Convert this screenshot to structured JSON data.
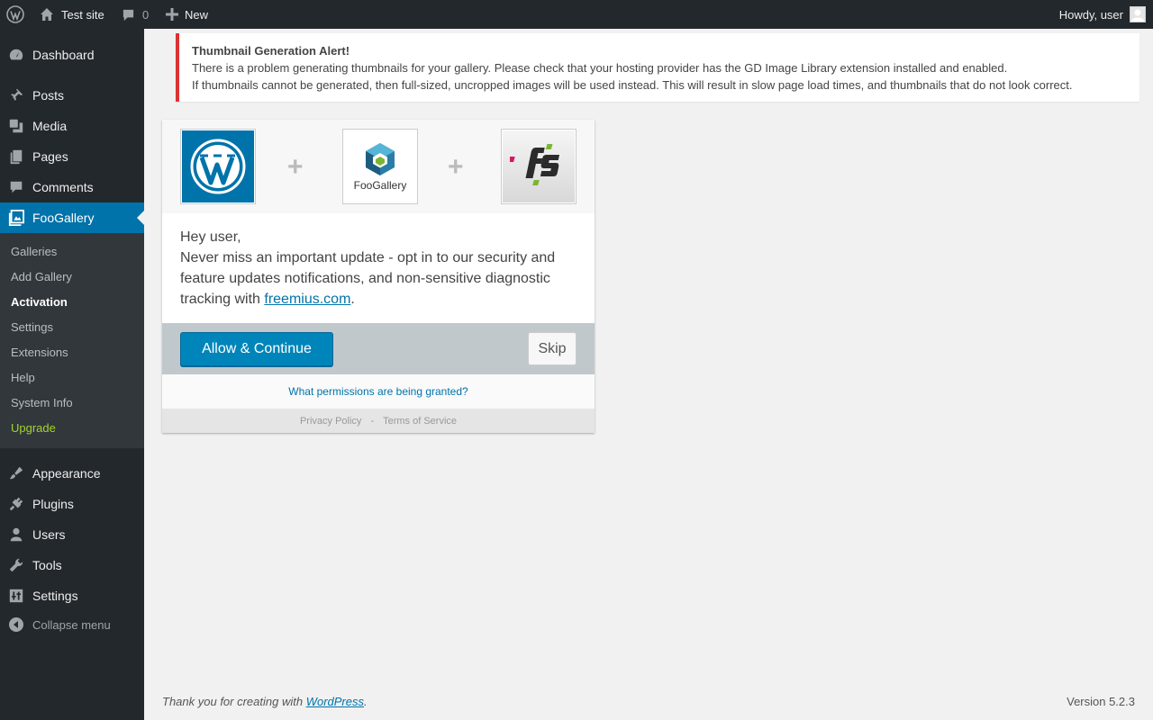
{
  "adminbar": {
    "site_name": "Test site",
    "comments_count": "0",
    "new_label": "New",
    "howdy": "Howdy, user"
  },
  "sidebar": {
    "items": [
      {
        "label": "Dashboard",
        "icon": "dashboard-icon"
      },
      {
        "label": "Posts",
        "icon": "pushpin-icon"
      },
      {
        "label": "Media",
        "icon": "media-icon"
      },
      {
        "label": "Pages",
        "icon": "pages-icon"
      },
      {
        "label": "Comments",
        "icon": "comment-icon"
      },
      {
        "label": "FooGallery",
        "icon": "gallery-icon",
        "current": true
      },
      {
        "label": "Appearance",
        "icon": "paintbrush-icon"
      },
      {
        "label": "Plugins",
        "icon": "plugin-icon"
      },
      {
        "label": "Users",
        "icon": "user-icon"
      },
      {
        "label": "Tools",
        "icon": "wrench-icon"
      },
      {
        "label": "Settings",
        "icon": "sliders-icon"
      }
    ],
    "submenu": [
      {
        "label": "Galleries"
      },
      {
        "label": "Add Gallery"
      },
      {
        "label": "Activation",
        "active": true
      },
      {
        "label": "Settings"
      },
      {
        "label": "Extensions"
      },
      {
        "label": "Help"
      },
      {
        "label": "System Info"
      },
      {
        "label": "Upgrade",
        "glyph": "",
        "color": "#a0d42b"
      }
    ],
    "collapse_label": "Collapse menu"
  },
  "notice": {
    "title": "Thumbnail Generation Alert!",
    "line1": "There is a problem generating thumbnails for your gallery. Please check that your hosting provider has the GD Image Library extension installed and enabled.",
    "line2": "If thumbnails cannot be generated, then full-sized, uncropped images will be used instead. This will result in slow page load times, and thumbnails that do not look correct.",
    "border_color": "#dc3232"
  },
  "optin": {
    "plus": "+",
    "foogallery_logo_text": "FooGallery",
    "greeting": "Hey user,",
    "message": "Never miss an important update - opt in to our security and feature updates notifications, and non-sensitive diagnostic tracking with ",
    "link_text": "freemius.com",
    "message_end": ".",
    "allow_label": "Allow & Continue ",
    "skip_label": "Skip",
    "permissions_link": "What permissions are being granted?",
    "privacy_label": "Privacy Policy",
    "separator": "-",
    "terms_label": "Terms of Service",
    "accent": "#0085ba"
  },
  "footer": {
    "thanks_prefix": "Thank you for creating with ",
    "wordpress_link": "WordPress",
    "thanks_suffix": ".",
    "version": "Version 5.2.3"
  }
}
